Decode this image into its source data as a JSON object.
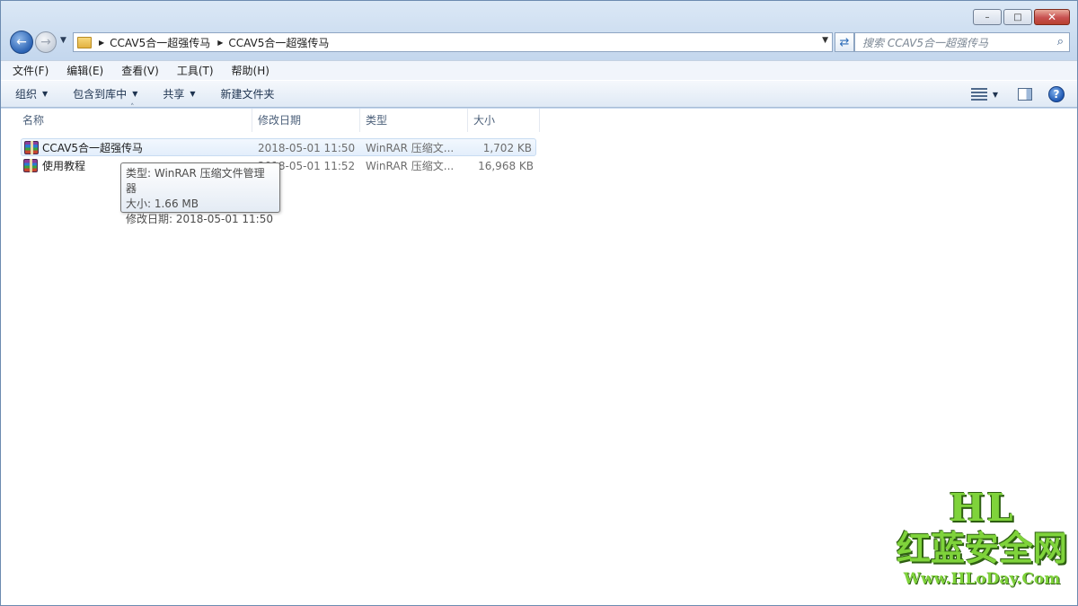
{
  "window": {
    "caption_buttons": {
      "minimize_icon": "minimize-icon",
      "maximize_icon": "maximize-icon",
      "close_icon": "close-icon"
    }
  },
  "address": {
    "crumbs": [
      "CCAV5合一超强传马",
      "CCAV5合一超强传马"
    ],
    "search_placeholder": "搜索 CCAV5合一超强传马"
  },
  "menu": {
    "items": [
      "文件(F)",
      "编辑(E)",
      "查看(V)",
      "工具(T)",
      "帮助(H)"
    ]
  },
  "toolbar": {
    "organize": "组织",
    "include_in_library": "包含到库中",
    "share": "共享",
    "new_folder": "新建文件夹"
  },
  "columns": {
    "name": "名称",
    "modified": "修改日期",
    "type": "类型",
    "size": "大小"
  },
  "files": [
    {
      "name": "CCAV5合一超强传马",
      "modified": "2018-05-01 11:50",
      "type": "WinRAR 压缩文...",
      "size": "1,702 KB"
    },
    {
      "name": "使用教程",
      "modified": "2018-05-01 11:52",
      "type": "WinRAR 压缩文...",
      "size": "16,968 KB"
    }
  ],
  "tooltip": {
    "line1": "类型: WinRAR 压缩文件管理器",
    "line2": "大小: 1.66 MB",
    "line3": "修改日期: 2018-05-01 11:50"
  },
  "watermark": {
    "brand": "HL",
    "name": "红蓝安全网",
    "url": "Www.HLoDay.Com"
  },
  "colors": {
    "selection": "#e3eefb",
    "watermark_green": "#7fd33b"
  }
}
